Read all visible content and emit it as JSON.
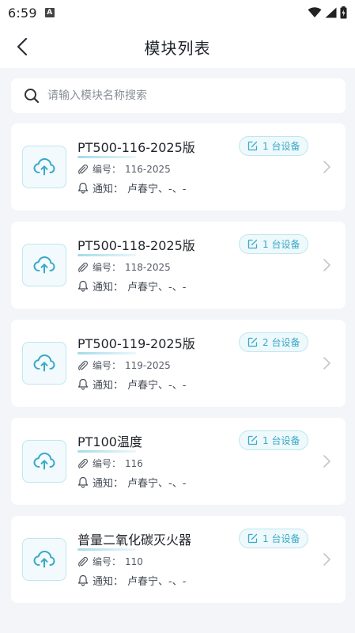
{
  "status_bar": {
    "time": "6:59",
    "notification_letter": "A"
  },
  "header": {
    "title": "模块列表",
    "back_icon": "chevron-left-icon"
  },
  "search": {
    "placeholder": "请输入模块名称搜索",
    "value": "",
    "icon": "search-icon"
  },
  "labels": {
    "code_prefix": "编号：",
    "notify_prefix": "通知："
  },
  "colors": {
    "accent": "#3aa9c6",
    "accent_light": "#eef9fc",
    "background": "#f3f5f8"
  },
  "modules": [
    {
      "name": "PT500-116-2025版",
      "device_count": "1 台设备",
      "code": "116-2025",
      "notify": "卢春宁、-、-"
    },
    {
      "name": "PT500-118-2025版",
      "device_count": "1 台设备",
      "code": "118-2025",
      "notify": "卢春宁、-、-"
    },
    {
      "name": "PT500-119-2025版",
      "device_count": "2 台设备",
      "code": "119-2025",
      "notify": "卢春宁、-、-"
    },
    {
      "name": "PT100温度",
      "device_count": "1 台设备",
      "code": "116",
      "notify": "卢春宁、-、-"
    },
    {
      "name": "普量二氧化碳灭火器",
      "device_count": "1 台设备",
      "code": "110",
      "notify": "卢春宁、-、-"
    }
  ]
}
